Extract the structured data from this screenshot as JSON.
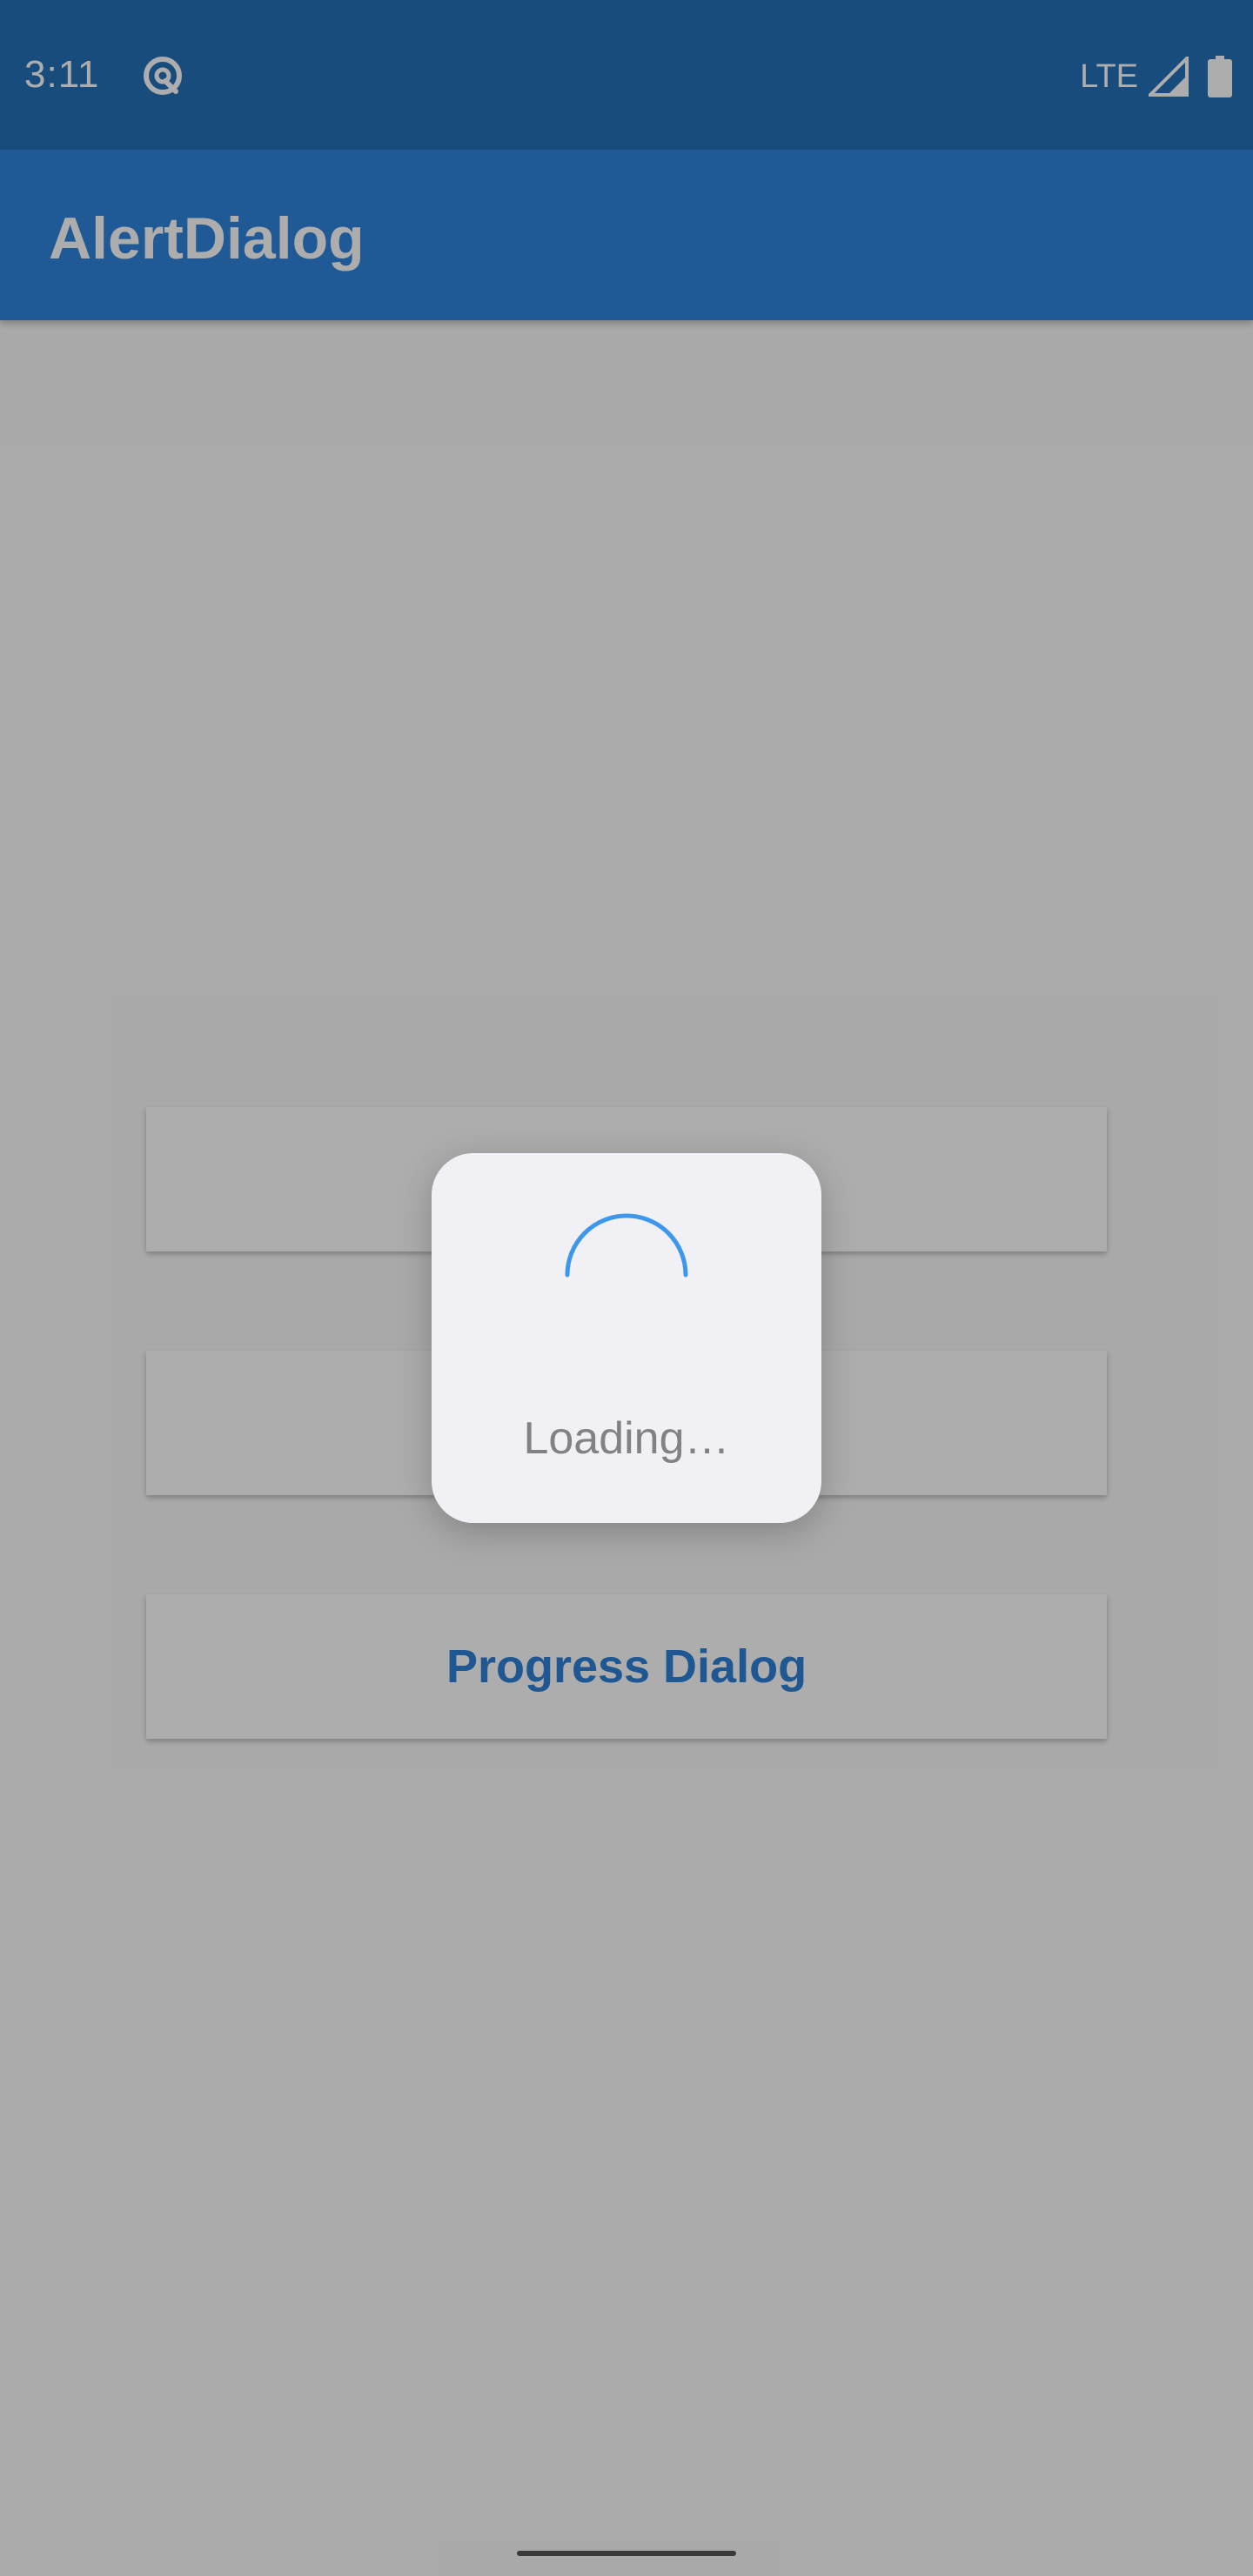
{
  "status_bar": {
    "time": "3:11",
    "network": "LTE",
    "app_icon": "at-sign-circle-icon",
    "signal_icon": "cell-signal-icon",
    "battery_icon": "battery-icon"
  },
  "app_bar": {
    "title": "AlertDialog"
  },
  "main": {
    "buttons": [
      {
        "label": ""
      },
      {
        "label": ""
      },
      {
        "label": "Progress Dialog"
      }
    ]
  },
  "dialog": {
    "message": "Loading…",
    "spinner_icon": "progress-spinner-icon"
  },
  "colors": {
    "status_bar": "#2470b8",
    "app_bar": "#2e83de",
    "accent": "#2e80d8",
    "spinner": "#3d97ec",
    "dialog_bg": "#f1f1f5"
  }
}
